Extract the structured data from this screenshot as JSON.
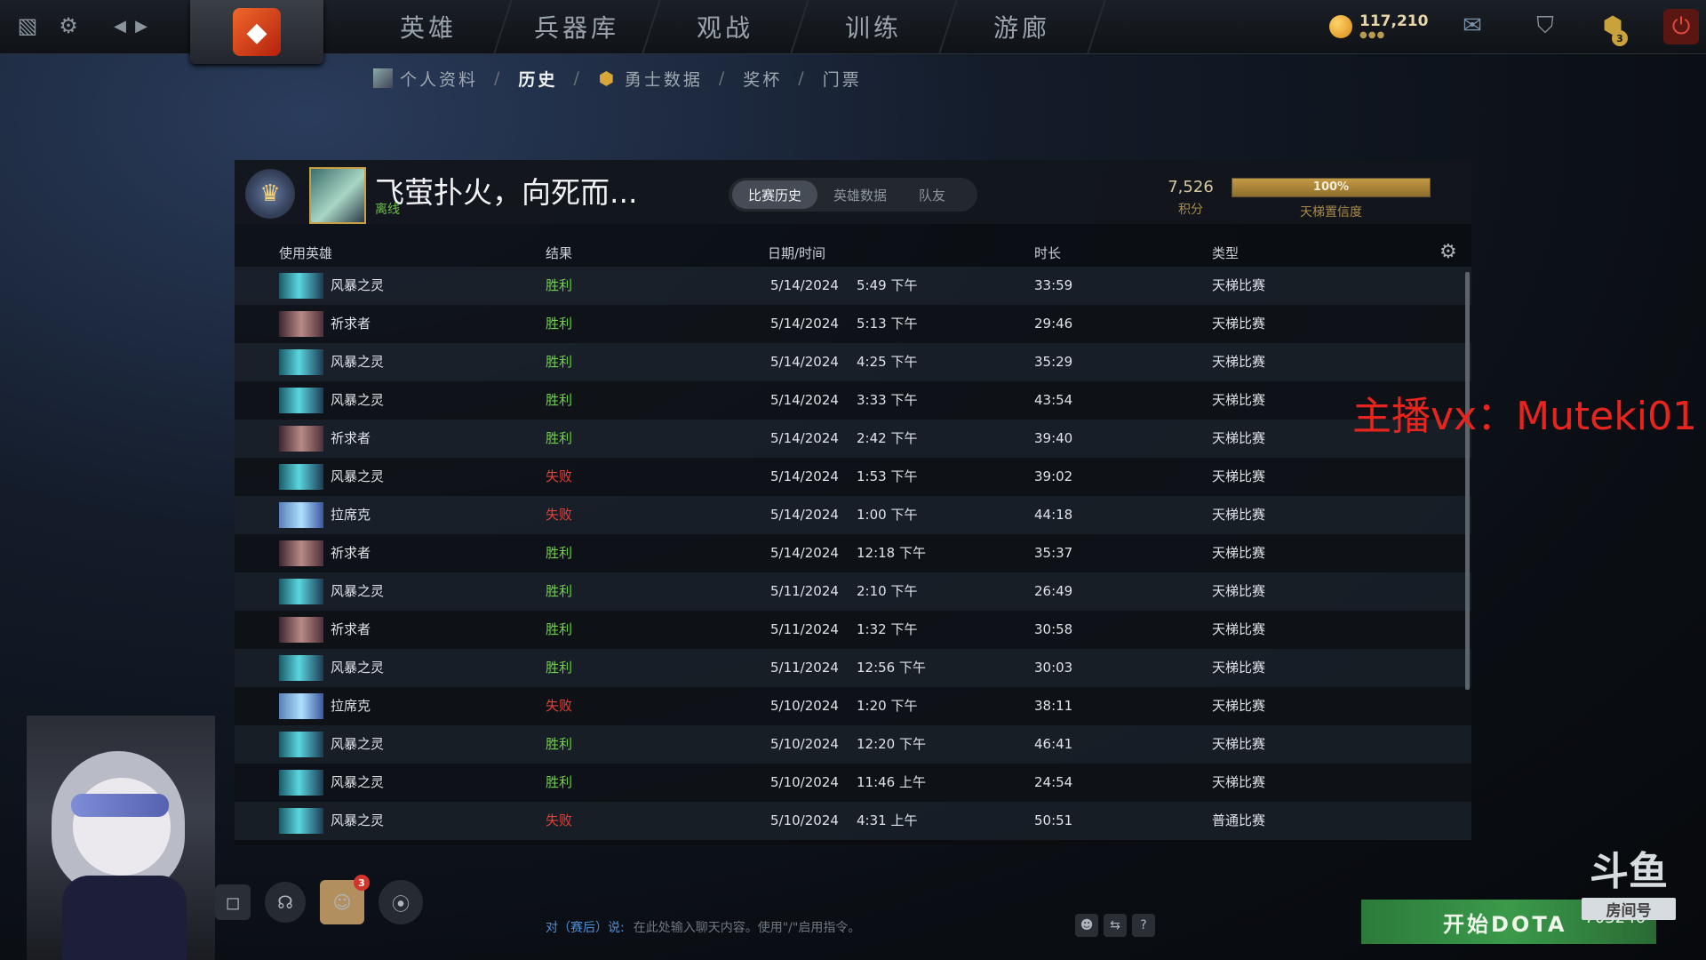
{
  "topbar": {
    "nav": [
      "英雄",
      "兵器库",
      "观战",
      "训练",
      "游廊"
    ],
    "gold_amount": "117,210",
    "gold_dots": "●●●",
    "notif_badge": "3"
  },
  "subnav": {
    "items": [
      "个人资料",
      "历史",
      "勇士数据",
      "奖杯",
      "门票"
    ],
    "active": "历史"
  },
  "profile": {
    "name": "飞萤扑火，向死而...",
    "status": "离线",
    "tabs": [
      "比赛历史",
      "英雄数据",
      "队友"
    ],
    "score_value": "7,526",
    "score_label": "积分",
    "confidence_value": "100%",
    "confidence_fraction": 1.0,
    "confidence_label": "天梯置信度"
  },
  "table": {
    "headers": [
      "使用英雄",
      "结果",
      "日期/时间",
      "时长",
      "类型"
    ],
    "rows": [
      {
        "hero": "风暴之灵",
        "icon": "storm-spirit",
        "result": "胜利",
        "outcome": "win",
        "date": "5/14/2024",
        "time": "5:49 下午",
        "duration": "33:59",
        "type": "天梯比赛"
      },
      {
        "hero": "祈求者",
        "icon": "invoker",
        "result": "胜利",
        "outcome": "win",
        "date": "5/14/2024",
        "time": "5:13 下午",
        "duration": "29:46",
        "type": "天梯比赛"
      },
      {
        "hero": "风暴之灵",
        "icon": "storm-spirit",
        "result": "胜利",
        "outcome": "win",
        "date": "5/14/2024",
        "time": "4:25 下午",
        "duration": "35:29",
        "type": "天梯比赛"
      },
      {
        "hero": "风暴之灵",
        "icon": "storm-spirit",
        "result": "胜利",
        "outcome": "win",
        "date": "5/14/2024",
        "time": "3:33 下午",
        "duration": "43:54",
        "type": "天梯比赛"
      },
      {
        "hero": "祈求者",
        "icon": "invoker",
        "result": "胜利",
        "outcome": "win",
        "date": "5/14/2024",
        "time": "2:42 下午",
        "duration": "39:40",
        "type": "天梯比赛"
      },
      {
        "hero": "风暴之灵",
        "icon": "storm-spirit",
        "result": "失败",
        "outcome": "lose",
        "date": "5/14/2024",
        "time": "1:53 下午",
        "duration": "39:02",
        "type": "天梯比赛"
      },
      {
        "hero": "拉席克",
        "icon": "leshrac",
        "result": "失败",
        "outcome": "lose",
        "date": "5/14/2024",
        "time": "1:00 下午",
        "duration": "44:18",
        "type": "天梯比赛"
      },
      {
        "hero": "祈求者",
        "icon": "invoker",
        "result": "胜利",
        "outcome": "win",
        "date": "5/14/2024",
        "time": "12:18 下午",
        "duration": "35:37",
        "type": "天梯比赛"
      },
      {
        "hero": "风暴之灵",
        "icon": "storm-spirit",
        "result": "胜利",
        "outcome": "win",
        "date": "5/11/2024",
        "time": "2:10 下午",
        "duration": "26:49",
        "type": "天梯比赛"
      },
      {
        "hero": "祈求者",
        "icon": "invoker",
        "result": "胜利",
        "outcome": "win",
        "date": "5/11/2024",
        "time": "1:32 下午",
        "duration": "30:58",
        "type": "天梯比赛"
      },
      {
        "hero": "风暴之灵",
        "icon": "storm-spirit",
        "result": "胜利",
        "outcome": "win",
        "date": "5/11/2024",
        "time": "12:56 下午",
        "duration": "30:03",
        "type": "天梯比赛"
      },
      {
        "hero": "拉席克",
        "icon": "leshrac",
        "result": "失败",
        "outcome": "lose",
        "date": "5/10/2024",
        "time": "1:20 下午",
        "duration": "38:11",
        "type": "天梯比赛"
      },
      {
        "hero": "风暴之灵",
        "icon": "storm-spirit",
        "result": "胜利",
        "outcome": "win",
        "date": "5/10/2024",
        "time": "12:20 下午",
        "duration": "46:41",
        "type": "天梯比赛"
      },
      {
        "hero": "风暴之灵",
        "icon": "storm-spirit",
        "result": "胜利",
        "outcome": "win",
        "date": "5/10/2024",
        "time": "11:46 上午",
        "duration": "24:54",
        "type": "天梯比赛"
      },
      {
        "hero": "风暴之灵",
        "icon": "storm-spirit",
        "result": "失败",
        "outcome": "lose",
        "date": "5/10/2024",
        "time": "4:31 上午",
        "duration": "50:51",
        "type": "普通比赛"
      }
    ]
  },
  "chat": {
    "target": "对（赛后）说:",
    "placeholder": "在此处输入聊天内容。使用\"/\"启用指令。"
  },
  "bottom": {
    "friends_badge": "3",
    "play_label": "开始DOTA",
    "room_number": "703246",
    "douyu_logo": "斗鱼",
    "douyu_sub": "房间号"
  },
  "overlay_text": "主播vx：Muteki01",
  "colors": {
    "win": "#6fd04a",
    "lose": "#e2413a",
    "accent_gold": "#c39a45"
  }
}
